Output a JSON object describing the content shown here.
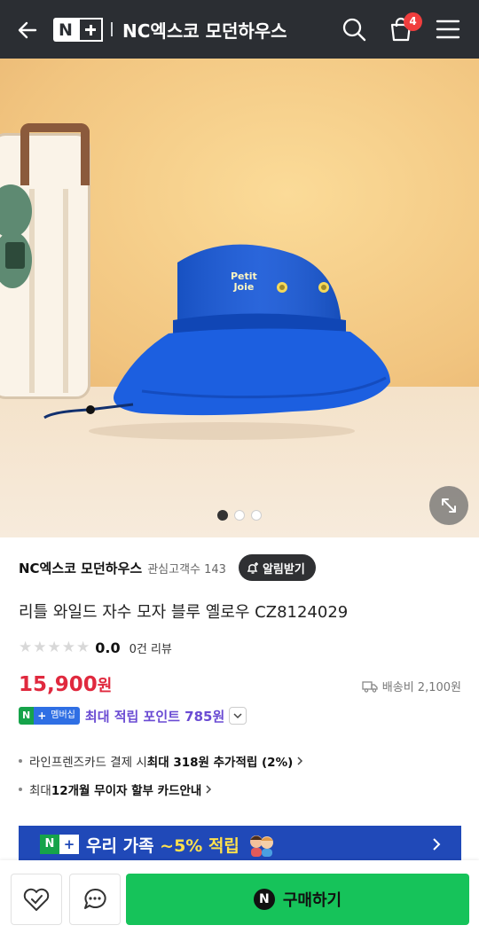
{
  "header": {
    "logo_n": "N",
    "title": "NC엑스코 모던하우스",
    "cart_count": "4",
    "colors": {
      "background": "#2b2e33",
      "badge": "#f03e3e"
    }
  },
  "hero": {
    "hat_text_1": "Petit",
    "hat_text_2": "Joie",
    "pagination": {
      "count": 3,
      "active_index": 0
    }
  },
  "product": {
    "store_name": "NC엑스코 모던하우스",
    "watchers": "관심고객수 143",
    "alarm_label": "알림받기",
    "name": "리틀 와일드 자수 모자 블루 옐로우 CZ8124029",
    "rating": "0.0",
    "review_count": "0건 리뷰",
    "price_amount": "15,900",
    "price_unit": "원",
    "shipping": "배송비 2,100원",
    "membership": {
      "badge_n": "N",
      "badge_plus": "+",
      "badge_label": "멤버십",
      "text": "최대 적립 포인트 785원"
    },
    "benefits": [
      {
        "pre": "라인프렌즈카드 결제 시 ",
        "bold": "최대 318원 추가적립 (2%)",
        "post": ""
      },
      {
        "pre": "최대 ",
        "bold": "12개월 무이자 할부 카드안내",
        "post": ""
      }
    ],
    "banner": {
      "n": "N",
      "plus": "+",
      "text": "우리 가족 ",
      "highlight": "~5% 적립"
    }
  },
  "bottom_bar": {
    "buy_logo": "N",
    "buy_label": "구매하기",
    "buy_color": "#16c35a"
  }
}
